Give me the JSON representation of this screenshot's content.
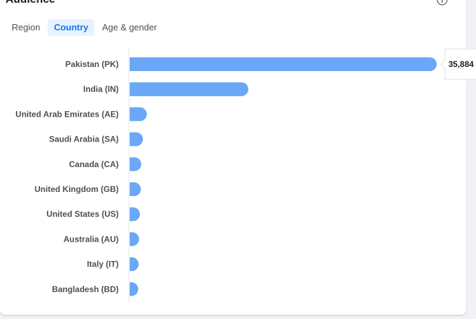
{
  "card": {
    "title": "Audience",
    "info_icon": "info-icon"
  },
  "tabs": [
    {
      "label": "Region",
      "active": false
    },
    {
      "label": "Country",
      "active": true
    },
    {
      "label": "Age & gender",
      "active": false
    }
  ],
  "colors": {
    "bar": "#6aa8f7",
    "tab_active_bg": "#e7f3ff",
    "tab_active_text": "#1a73e8"
  },
  "chart_data": {
    "type": "bar",
    "orientation": "horizontal",
    "categories": [
      "Pakistan (PK)",
      "India (IN)",
      "United Arab Emirates (AE)",
      "Saudi Arabia (SA)",
      "Canada (CA)",
      "United Kingdom (GB)",
      "United States (US)",
      "Australia (AU)",
      "Italy (IT)",
      "Bangladesh (BD)"
    ],
    "values": [
      35884,
      13870,
      2000,
      1550,
      1350,
      1300,
      1200,
      1100,
      1050,
      1000
    ],
    "xlim": [
      0,
      35884
    ],
    "tooltip": {
      "category": "Pakistan (PK)",
      "text": "35,884"
    },
    "grid": false,
    "legend": "none"
  }
}
